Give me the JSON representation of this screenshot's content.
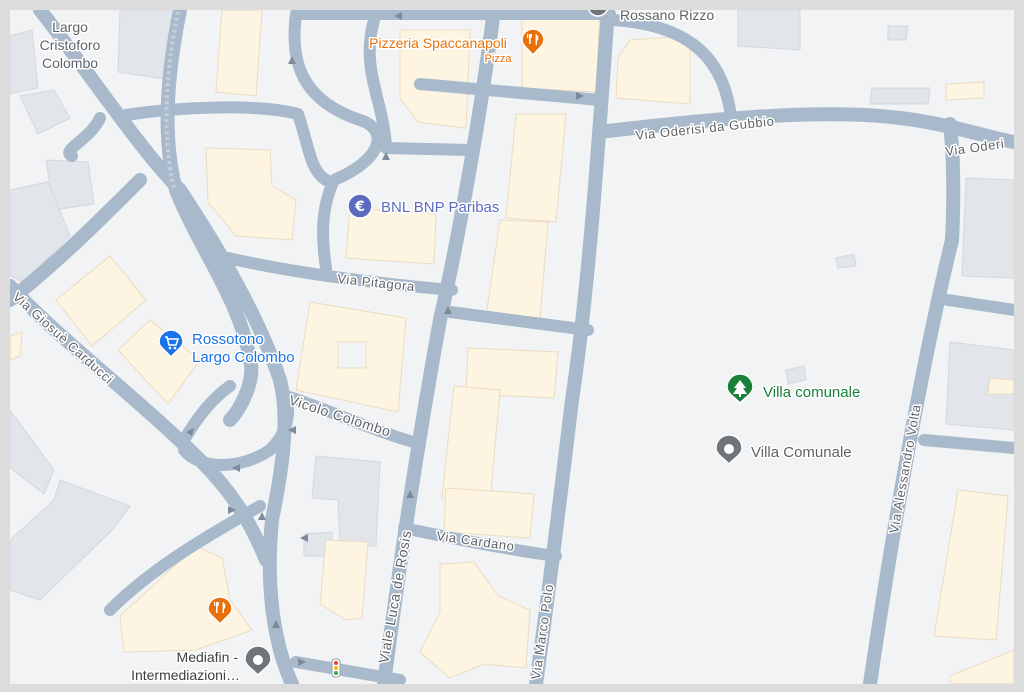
{
  "map": {
    "colors": {
      "background": "#f1f3f4",
      "road": "#a7b9cb",
      "building": "#fdf4e2",
      "building_grey": "#e2e5ea",
      "street_label": "#5f6368",
      "restaurant": "#e8710a",
      "bank": "#5c6bc0",
      "shopping": "#1a73e8",
      "park": "#188038",
      "generic_place": "#70757a"
    },
    "streets": {
      "via_oderisi_da_gubbio": "Via Oderisi da Gubbio",
      "via_oderisi_da_gubbio_2": "Via Oderi",
      "via_pitagora": "Via Pitagora",
      "vicolo_colombo": "Vicolo Colombo",
      "via_giosue_carducci": "Via Giosuè Carducci",
      "viale_luca_de_rosis": "Viale Luca de Rosis",
      "via_cardano": "Via Cardano",
      "via_marco_polo": "Via Marco Polo",
      "via_alessandro_volta": "Via Alessandro Volta"
    },
    "places": {
      "largo_cristoforo_colombo": {
        "line1": "Largo",
        "line2": "Cristoforo",
        "line3": "Colombo"
      },
      "pizzeria": {
        "name": "Pizzeria Spaccanapoli",
        "category": "Pizza",
        "icon": "fork-knife-icon"
      },
      "rossano_rizzo": {
        "name": "Rossano Rizzo",
        "icon": "place-pin-icon"
      },
      "bnl": {
        "name": "BNL BNP Paribas",
        "icon": "euro-icon"
      },
      "rossotono": {
        "line1": "Rossotono",
        "line2": "Largo Colombo",
        "icon": "shopping-cart-icon"
      },
      "villa_park": {
        "name": "Villa comunale",
        "icon": "tree-icon"
      },
      "villa_place": {
        "name": "Villa Comunale",
        "icon": "place-pin-icon"
      },
      "restaurant_unnamed": {
        "icon": "fork-knife-icon"
      },
      "mediafin": {
        "line1": "Mediafin -",
        "line2": "Intermediazioni…",
        "icon": "place-pin-icon"
      },
      "traffic_light": {
        "icon": "traffic-light-icon"
      }
    }
  }
}
